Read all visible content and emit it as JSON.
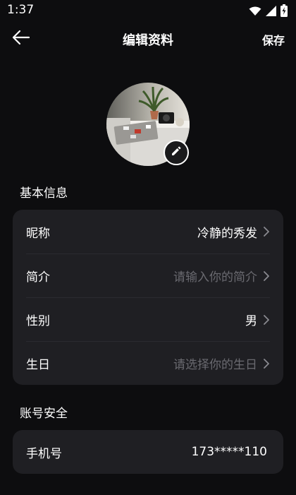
{
  "status": {
    "time": "1:37"
  },
  "header": {
    "title": "编辑资料",
    "save_label": "保存"
  },
  "sections": [
    {
      "title": "基本信息",
      "rows": [
        {
          "label": "昵称",
          "value": "冷静的秀发"
        },
        {
          "label": "简介",
          "placeholder": "请输入你的简介"
        },
        {
          "label": "性别",
          "value": "男"
        },
        {
          "label": "生日",
          "placeholder": "请选择你的生日"
        }
      ]
    },
    {
      "title": "账号安全",
      "rows": [
        {
          "label": "手机号",
          "value": "173*****110"
        }
      ]
    }
  ],
  "icons": {
    "back": "arrow-left-icon",
    "edit": "pencil-icon",
    "chevron": "chevron-right-icon",
    "wifi": "wifi-icon",
    "signal": "signal-icon",
    "battery": "battery-icon"
  }
}
